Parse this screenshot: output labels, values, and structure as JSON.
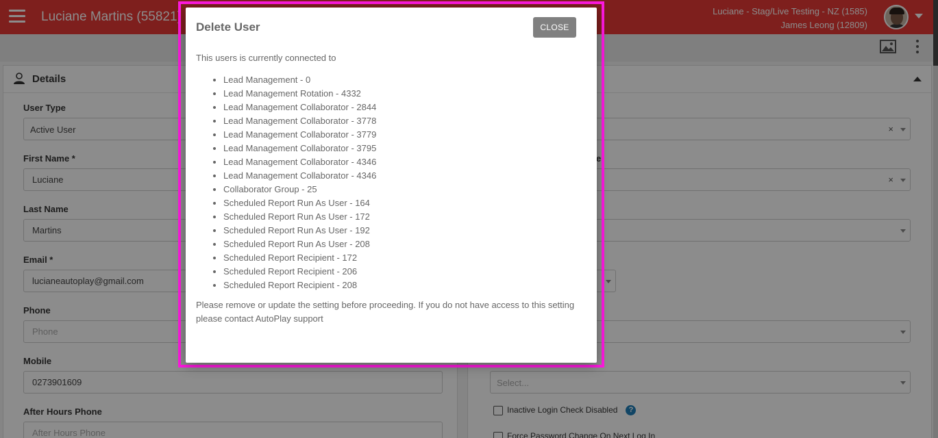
{
  "header": {
    "title": "Luciane Martins (55821)",
    "account_line1": "Luciane - Stag/Live Testing - NZ (1585)",
    "account_line2": "James Leong (12809)"
  },
  "details_panel": {
    "title": "Details",
    "fields": {
      "user_type": {
        "label": "User Type",
        "value": "Active User"
      },
      "first_name": {
        "label": "First Name *",
        "value": "Luciane"
      },
      "last_name": {
        "label": "Last Name",
        "value": "Martins"
      },
      "email": {
        "label": "Email *",
        "value": "lucianeautoplay@gmail.com"
      },
      "phone": {
        "label": "Phone",
        "value": "",
        "placeholder": "Phone"
      },
      "mobile": {
        "label": "Mobile",
        "value": "0273901609"
      },
      "after_hours_phone": {
        "label": "After Hours Phone",
        "value": "",
        "placeholder": "After Hours Phone"
      }
    }
  },
  "right_panel": {
    "partial_label": "e",
    "select_placeholder": "Select...",
    "inactive_login_check": "Inactive Login Check Disabled",
    "force_password_change": "Force Password Change On Next Log In",
    "help_glyph": "?",
    "clear_glyph": "×"
  },
  "modal": {
    "title": "Delete User",
    "close_label": "CLOSE",
    "intro": "This users is currently connected to",
    "items": [
      "Lead Management - 0",
      "Lead Management Rotation - 4332",
      "Lead Management Collaborator - 2844",
      "Lead Management Collaborator - 3778",
      "Lead Management Collaborator - 3779",
      "Lead Management Collaborator - 3795",
      "Lead Management Collaborator - 4346",
      "Lead Management Collaborator - 4346",
      "Collaborator Group - 25",
      "Scheduled Report Run As User - 164",
      "Scheduled Report Run As User - 172",
      "Scheduled Report Run As User - 192",
      "Scheduled Report Run As User - 208",
      "Scheduled Report Recipient - 172",
      "Scheduled Report Recipient - 206",
      "Scheduled Report Recipient - 208"
    ],
    "footer": "Please remove or update the setting before proceeding. If you do not have access to this setting please contact AutoPlay support"
  },
  "colors": {
    "header_bg": "#e53935",
    "highlight_border": "#ff19e0",
    "close_button_bg": "#808080",
    "help_icon_bg": "#1f7fb8"
  }
}
